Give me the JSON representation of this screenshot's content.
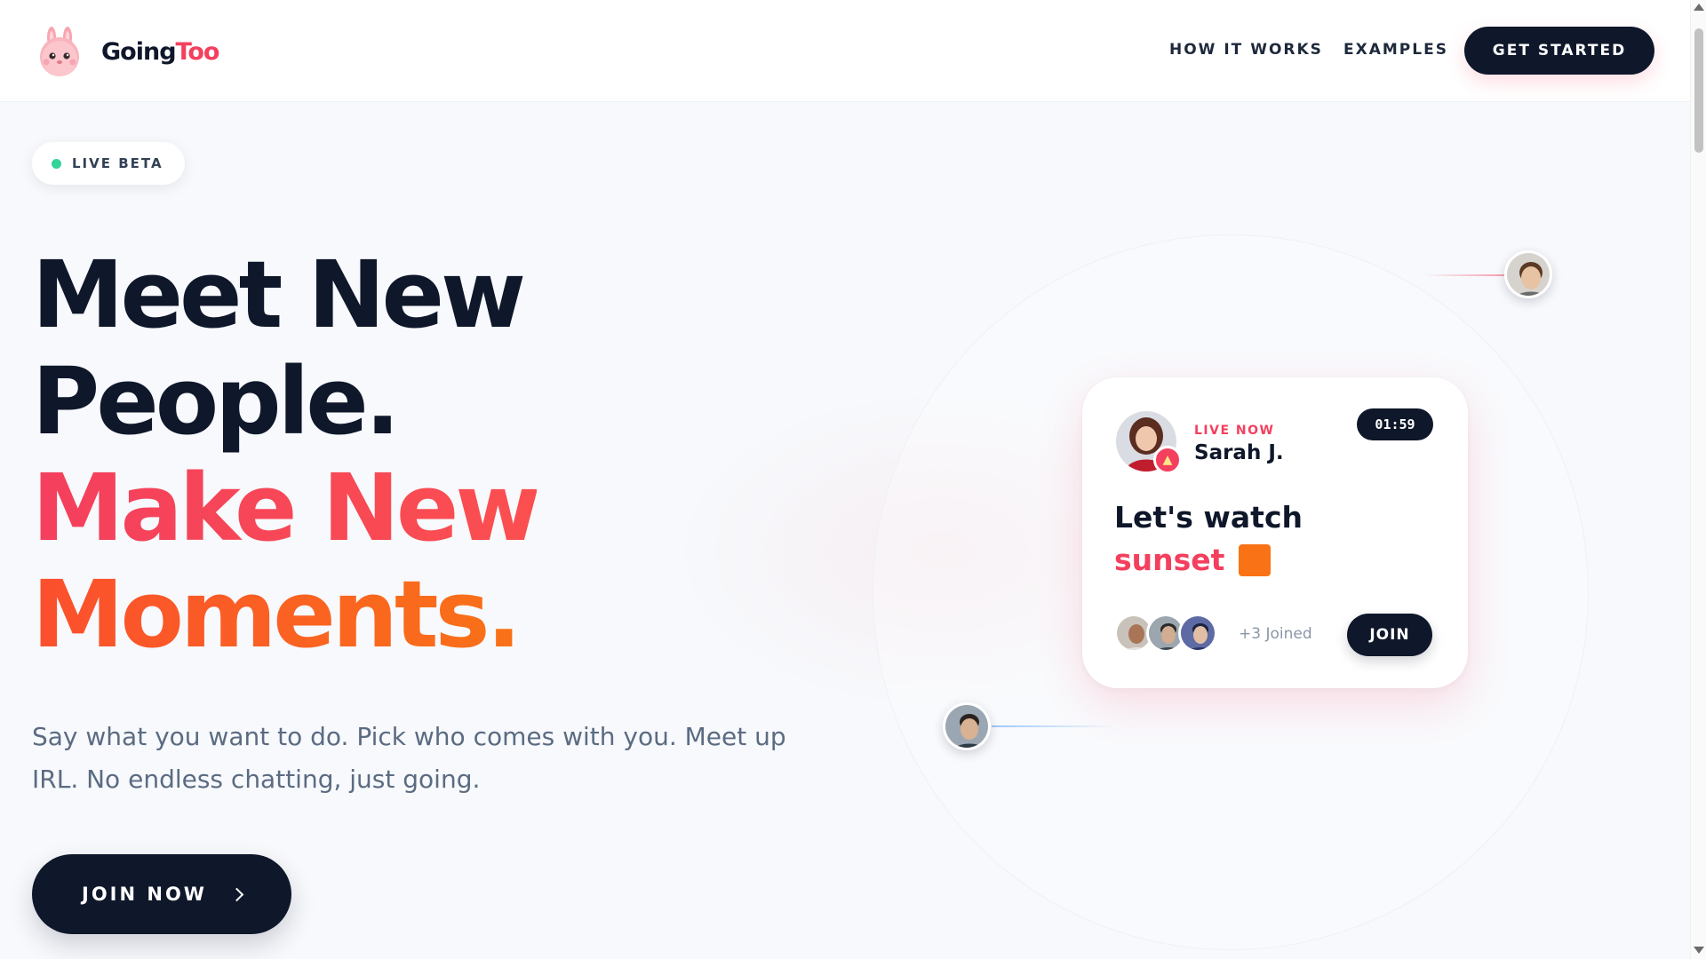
{
  "header": {
    "logo_text_a": "Going",
    "logo_text_b": "Too",
    "nav": [
      "HOW IT WORKS",
      "EXAMPLES"
    ],
    "cta": "GET STARTED"
  },
  "badge": {
    "label": "LIVE BETA",
    "dot_color": "#34d399"
  },
  "hero": {
    "line1": "Meet New",
    "line2": "People.",
    "line3": "Make New",
    "line4": "Moments.",
    "subtitle": "Say what you want to do. Pick who comes with you. Meet up IRL. No endless chatting, just going.",
    "cta": "JOIN NOW"
  },
  "card": {
    "status": "LIVE NOW",
    "host": "Sarah J.",
    "timer": "01:59",
    "activity_line1": "Let's watch",
    "activity_line2": "sunset",
    "joined": "+3 Joined",
    "join": "JOIN"
  },
  "colors": {
    "primary": "#0f172a",
    "accent_pink": "#f43f5e",
    "accent_orange": "#f97316",
    "live_green": "#34d399"
  },
  "icons": [
    "bunny-logo-icon",
    "fire-icon",
    "chevron-right-icon"
  ]
}
